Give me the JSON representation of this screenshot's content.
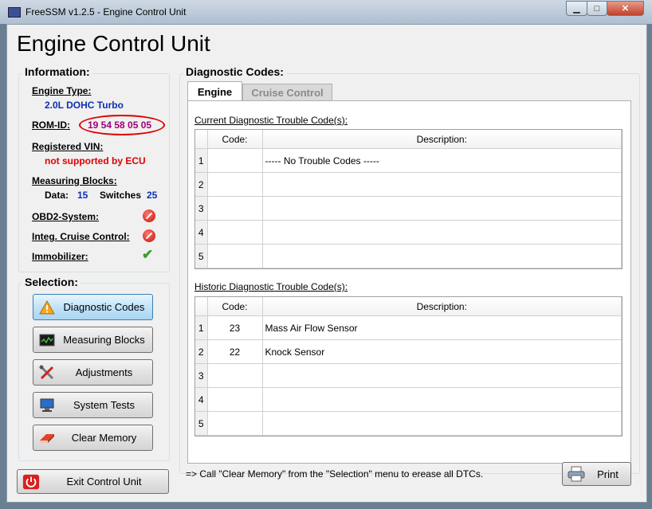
{
  "window": {
    "title": "FreeSSM v1.2.5 - Engine Control Unit"
  },
  "page": {
    "title": "Engine Control Unit"
  },
  "information": {
    "heading": "Information:",
    "engine_type_label": "Engine Type:",
    "engine_type_value": "2.0L DOHC Turbo",
    "rom_id_label": "ROM-ID:",
    "rom_id_value": "19 54 58 05 05",
    "vin_label": "Registered VIN:",
    "vin_value": "not supported by ECU",
    "measuring_blocks_label": "Measuring Blocks:",
    "data_label": "Data:",
    "data_value": "15",
    "switches_label": "Switches",
    "switches_value": "25",
    "obd2_label": "OBD2-System:",
    "cruise_label": "Integ. Cruise Control:",
    "immobilizer_label": "Immobilizer:",
    "obd2_status": "not-supported-icon",
    "cruise_status": "not-supported-icon",
    "immobilizer_status": "checkmark-icon"
  },
  "selection": {
    "heading": "Selection:",
    "buttons": [
      {
        "label": "Diagnostic Codes",
        "icon": "warning-icon",
        "active": true
      },
      {
        "label": "Measuring Blocks",
        "icon": "monitor-graph-icon",
        "active": false
      },
      {
        "label": "Adjustments",
        "icon": "tools-icon",
        "active": false
      },
      {
        "label": "System Tests",
        "icon": "computer-icon",
        "active": false
      },
      {
        "label": "Clear Memory",
        "icon": "eraser-icon",
        "active": false
      }
    ],
    "exit_label": "Exit Control Unit"
  },
  "diagnostic": {
    "heading": "Diagnostic Codes:",
    "tabs": [
      {
        "label": "Engine",
        "selected": true
      },
      {
        "label": "Cruise Control",
        "selected": false
      }
    ],
    "current_title": "Current Diagnostic Trouble Code(s):",
    "historic_title": "Historic Diagnostic Trouble Code(s):",
    "col_code": "Code:",
    "col_desc": "Description:",
    "current_rows": [
      {
        "n": "1",
        "code": "",
        "desc": "----- No Trouble Codes -----"
      },
      {
        "n": "2",
        "code": "",
        "desc": ""
      },
      {
        "n": "3",
        "code": "",
        "desc": ""
      },
      {
        "n": "4",
        "code": "",
        "desc": ""
      },
      {
        "n": "5",
        "code": "",
        "desc": ""
      }
    ],
    "historic_rows": [
      {
        "n": "1",
        "code": "23",
        "desc": "Mass Air Flow Sensor"
      },
      {
        "n": "2",
        "code": "22",
        "desc": "Knock Sensor"
      },
      {
        "n": "3",
        "code": "",
        "desc": ""
      },
      {
        "n": "4",
        "code": "",
        "desc": ""
      },
      {
        "n": "5",
        "code": "",
        "desc": ""
      }
    ]
  },
  "footer": {
    "note": "=> Call \"Clear Memory\" from the \"Selection\" menu to erease all DTCs.",
    "print_label": "Print"
  },
  "colors": {
    "accent_blue": "#0b2fb3",
    "alert_red": "#e00000",
    "rom_purple": "#a0007a",
    "active_button": "#a9d6f3"
  }
}
